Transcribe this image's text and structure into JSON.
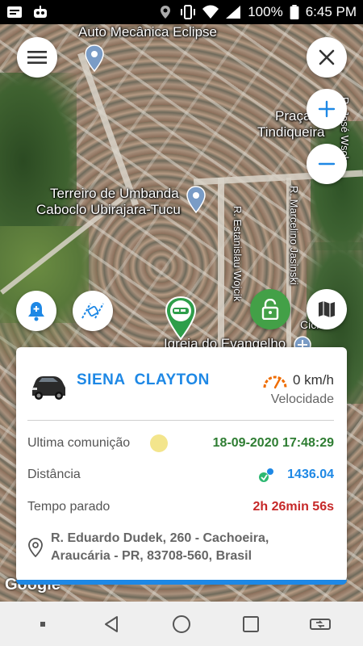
{
  "status_bar": {
    "battery_percent": "100%",
    "time": "6:45 PM",
    "icons": [
      "notification-icon",
      "robot-icon",
      "location-icon",
      "vibrate-icon",
      "wifi-icon",
      "signal-icon",
      "battery-icon"
    ]
  },
  "map": {
    "labels": {
      "auto_mecanica": "Auto Mecânica Eclipse",
      "praca_line1": "Praça",
      "praca_line2": "Tindiqueira",
      "terreiro_line1": "Terreiro de Umbanda",
      "terreiro_line2": "Caboclo Ubirajara-Tucu",
      "igreja": "Igreja do Evangelho",
      "estanislau": "R. Estanislau Wojcik",
      "marcelino": "R. Marcelino Jasinski",
      "jose_wsok": "R. José Wsok",
      "cich": "Cich"
    },
    "attribution": "Google"
  },
  "buttons": {
    "menu": "menu-icon",
    "close": "close-icon",
    "zoom_in": "plus-icon",
    "zoom_out": "minus-icon",
    "alert": "bell-icon",
    "route": "route-car-icon",
    "lock": "lock-icon",
    "map_type": "map-icon"
  },
  "vehicle": {
    "name": "SIENA  CLAYTON",
    "speed": "0 km/h",
    "speed_label": "Velocidade",
    "last_comm_label": "Ultima comunição",
    "last_comm_value": "18-09-2020 17:48:29",
    "distance_label": "Distância",
    "distance_value": "1436.04",
    "stopped_label": "Tempo parado",
    "stopped_value": "2h 26min 56s",
    "address": "R. Eduardo Dudek, 260 - Cachoeira, Araucária - PR, 83708-560, Brasil"
  },
  "colors": {
    "accent_blue": "#1e88e5",
    "green": "#2e7d32",
    "red": "#c62828",
    "lock_green": "#43a047",
    "speed_orange": "#ef6c00"
  }
}
